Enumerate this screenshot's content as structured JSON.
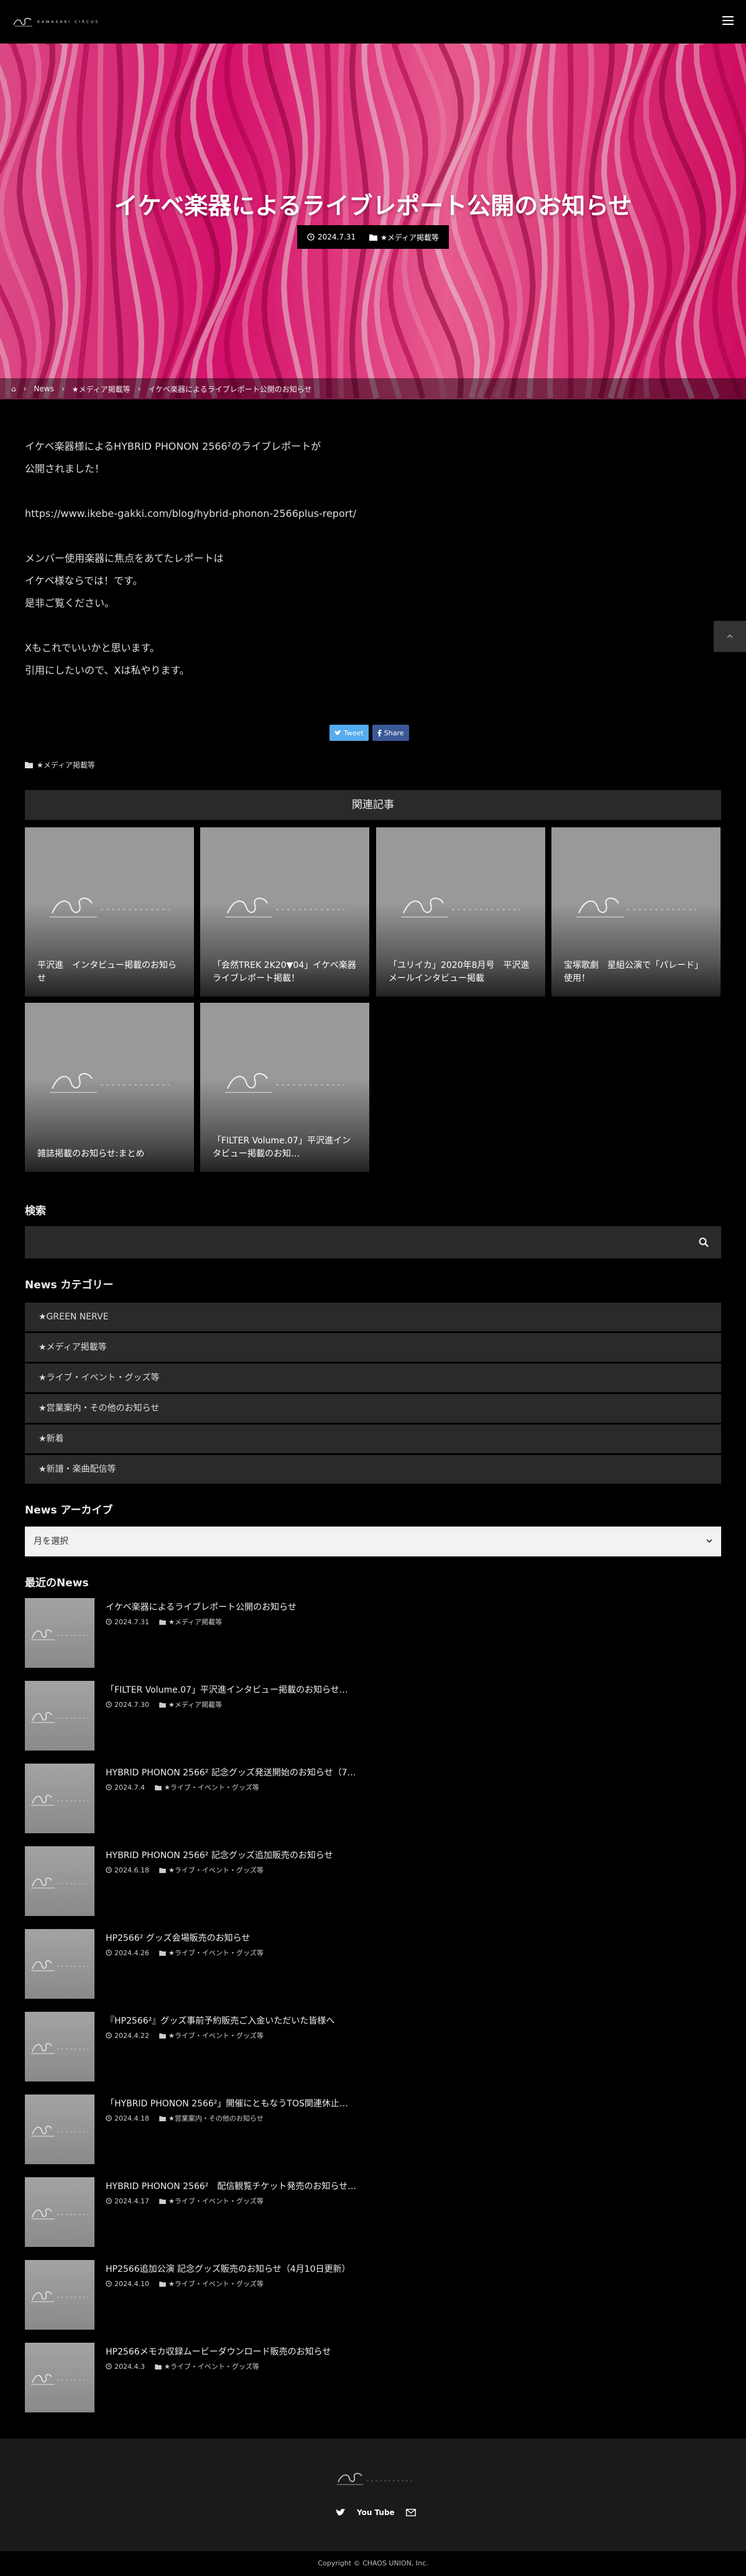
{
  "header": {
    "logo_text": "KAWASAKI CIRCUS"
  },
  "hero": {
    "title": "イケベ楽器によるライブレポート公開のお知らせ",
    "date": "2024.7.31",
    "category": "★メディア掲載等"
  },
  "breadcrumb": {
    "home": "⌂",
    "news": "News",
    "category": "★メディア掲載等",
    "current": "イケベ楽器によるライブレポート公開のお知らせ"
  },
  "article": {
    "paragraphs": [
      "イケベ楽器様によるHYBRID PHONON 2566²のライブレポートが",
      "公開されました！",
      "",
      "https://www.ikebe-gakki.com/blog/hybrid-phonon-2566plus-report/",
      "",
      "メンバー使用楽器に焦点をあてたレポートは",
      "イケベ様ならでは！です。",
      "是非ご覧ください。",
      "",
      "Xもこれでいいかと思います。",
      "引用にしたいので、Xは私やります。"
    ],
    "tweet_label": "Tweet",
    "share_label": "Share",
    "post_category": "★メディア掲載等"
  },
  "related": {
    "heading": "関連記事",
    "cards": [
      "平沢進　インタビュー掲載のお知らせ",
      "「会然TREK 2K20▼04」イケベ楽器ライブレポート掲載！",
      "「ユリイカ」2020年8月号　平沢進メールインタビュー掲載",
      "宝塚歌劇　星組公演で「パレード」使用！",
      "雑誌掲載のお知らせ:まとめ",
      "「FILTER Volume.07」平沢進インタビュー掲載のお知…"
    ]
  },
  "search": {
    "title": "検索"
  },
  "categories": {
    "title": "News カテゴリー",
    "items": [
      "★GREEN NERVE",
      "★メディア掲載等",
      "★ライブ・イベント・グッズ等",
      "★営業案内・その他のお知らせ",
      "★新着",
      "★新譜・楽曲配信等"
    ]
  },
  "archive": {
    "title": "News アーカイブ",
    "selected": "月を選択"
  },
  "recent": {
    "title": "最近のNews",
    "items": [
      {
        "title": "イケベ楽器によるライブレポート公開のお知らせ",
        "date": "2024.7.31",
        "category": "★メディア掲載等"
      },
      {
        "title": "「FILTER Volume.07」平沢進インタビュー掲載のお知らせ…",
        "date": "2024.7.30",
        "category": "★メディア掲載等"
      },
      {
        "title": "HYBRID PHONON 2566² 記念グッズ発送開始のお知らせ（7…",
        "date": "2024.7.4",
        "category": "★ライブ・イベント・グッズ等"
      },
      {
        "title": "HYBRID PHONON 2566² 記念グッズ追加販売のお知らせ",
        "date": "2024.6.18",
        "category": "★ライブ・イベント・グッズ等"
      },
      {
        "title": "HP2566² グッズ会場販売のお知らせ",
        "date": "2024.4.26",
        "category": "★ライブ・イベント・グッズ等"
      },
      {
        "title": "『HP2566²』グッズ事前予約販売ご入金いただいた皆様へ",
        "date": "2024.4.22",
        "category": "★ライブ・イベント・グッズ等"
      },
      {
        "title": "「HYBRID PHONON 2566²」開催にともなうTOS関連休止…",
        "date": "2024.4.18",
        "category": "★営業案内・その他のお知らせ"
      },
      {
        "title": "HYBRID PHONON 2566²　配信観覧チケット発売のお知らせ…",
        "date": "2024.4.17",
        "category": "★ライブ・イベント・グッズ等"
      },
      {
        "title": "HP2566追加公演 記念グッズ販売のお知らせ（4月10日更新）",
        "date": "2024.4.10",
        "category": "★ライブ・イベント・グッズ等"
      },
      {
        "title": "HP2566メモカ収録ムービーダウンロード販売のお知らせ",
        "date": "2024.4.3",
        "category": "★ライブ・イベント・グッズ等"
      }
    ]
  },
  "footer": {
    "youtube_label": "You Tube",
    "copyright": "Copyright © CHAOS UNION, Inc."
  },
  "colors": {
    "background": "#000000",
    "panel": "#2a2a2a",
    "hero_pink": "#e8147a",
    "twitter": "#55acee",
    "facebook": "#3b5998"
  }
}
